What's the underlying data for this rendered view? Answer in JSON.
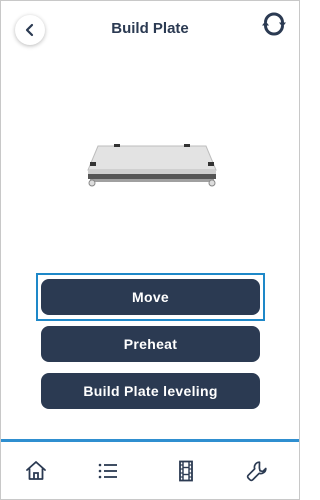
{
  "header": {
    "title": "Build Plate",
    "back_icon": "chevron-left-icon",
    "sync_icon": "sync-icon"
  },
  "actions": [
    {
      "label": "Move",
      "selected": true
    },
    {
      "label": "Preheat",
      "selected": false
    },
    {
      "label": "Build Plate leveling",
      "selected": false
    }
  ],
  "nav": {
    "items": [
      {
        "icon": "home-icon"
      },
      {
        "icon": "list-icon"
      },
      {
        "icon": "film-icon"
      },
      {
        "icon": "wrench-icon"
      }
    ]
  },
  "colors": {
    "primary": "#2b3a52",
    "selection": "#1e88c8",
    "nav_line": "#2f8fd0"
  }
}
